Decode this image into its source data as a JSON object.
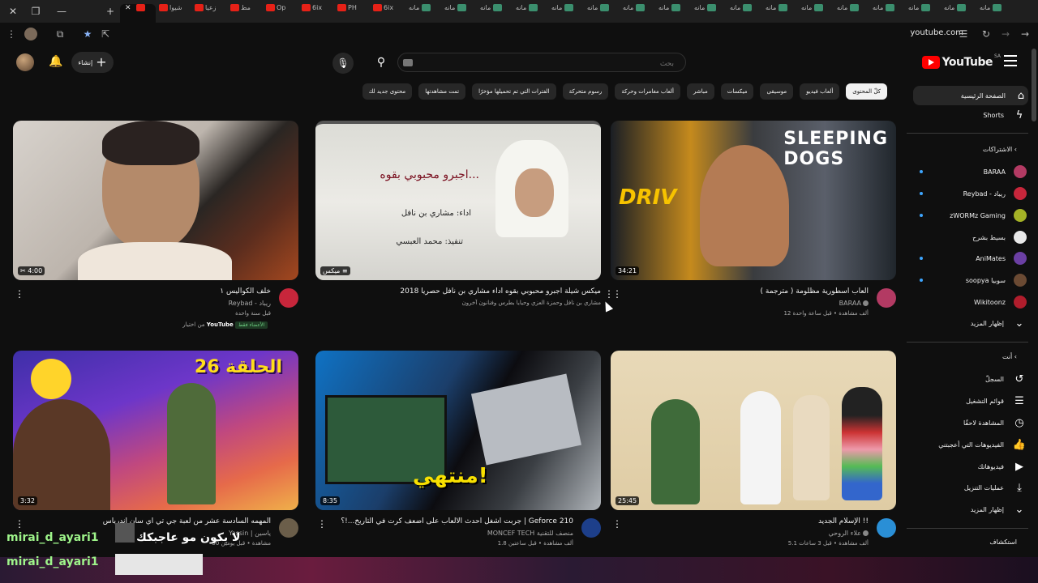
{
  "browser": {
    "tabs": [
      "شيوا",
      "زعيا",
      "مط",
      "Op",
      "6ix",
      "PH",
      "6ix",
      "مانه",
      "مانه",
      "مانه",
      "مانه",
      "مانه",
      "مانه",
      "مانه",
      "مانه",
      "مانه",
      "مانه",
      "مانه",
      "مانه",
      "مانه",
      "مانه",
      "مانه",
      "مانه"
    ],
    "url": "youtube.com"
  },
  "header": {
    "logo_text": "YouTube",
    "logo_region": "SA",
    "search_placeholder": "بحث",
    "create_label": "إنشاء"
  },
  "chips": [
    "كلّ المحتوى",
    "ألعاب فيديو",
    "موسيقى",
    "ميكسات",
    "مباشر",
    "ألعاب مغامرات وحركة",
    "رسوم متحركة",
    "الفترات التي تم تحميلها مؤخرًا",
    "تمت مشاهدتها",
    "محتوى جديد لك"
  ],
  "sidebar": {
    "main": [
      {
        "label": "الصفحة الرئيسية",
        "icon": "home-icon"
      },
      {
        "label": "Shorts",
        "icon": "shorts-icon"
      }
    ],
    "subscriptions_heading": "الاشتراكات",
    "subscriptions": [
      {
        "label": "BARAA",
        "color": "#b33a63"
      },
      {
        "label": "Reybad - ريباد",
        "color": "#c7263b"
      },
      {
        "label": "zWORMz Gaming",
        "color": "#a4b226"
      },
      {
        "label": "بسيط بشرح",
        "color": "#e8e8e8"
      },
      {
        "label": "AniMates",
        "color": "#6b3fa3"
      },
      {
        "label": "soopya سوبيا",
        "color": "#6b4a33"
      },
      {
        "label": "Wikitoonz",
        "color": "#b01d2c"
      }
    ],
    "show_more": "إظهار المزيد",
    "you_heading": "أنت",
    "you": [
      {
        "label": "السجلّ",
        "icon": "history-icon"
      },
      {
        "label": "قوائم التشغيل",
        "icon": "playlists-icon"
      },
      {
        "label": "المشاهدة لاحقًا",
        "icon": "watch-later-icon"
      },
      {
        "label": "الفيديوهات التي أعجبتني",
        "icon": "like-icon"
      },
      {
        "label": "فيديوهاتك",
        "icon": "your-videos-icon"
      },
      {
        "label": "عمليات التنزيل",
        "icon": "download-icon"
      }
    ],
    "show_more_2": "إظهار المزيد",
    "explore_heading": "استكشاف"
  },
  "videos": [
    {
      "title": "ألعاب أسطورية مظلومة ( مترجمة )",
      "channel": "BARAA",
      "stats": "12 ألف مشاهدة • قبل ساعة واحدة",
      "duration": "34:21",
      "avatar_color": "#b33a63",
      "thumb": "t3"
    },
    {
      "title": "ميكس شيلة اجبرو محبوبي بقوه   اداء مشاري بن نافل   حصريا 2018",
      "channel": "مشاري بن نافل وحمزة العزي وحيايا بطرس وفنانون آخرون",
      "stats": "",
      "duration": "ميكس",
      "avatar_color": "",
      "thumb": "t2"
    },
    {
      "title": "خلف الكواليس ١",
      "channel": "Reybad - ريباد",
      "stats": "قبل سنة واحدة",
      "extra_pre": "من اختيار",
      "extra_brand": "YouTube",
      "extra_badge": "الأعضاء فقط",
      "duration": "4:00",
      "avatar_color": "#c7263b",
      "thumb": "t1"
    },
    {
      "title": "الإسلام الجديد !!",
      "channel": "علاء الروحي",
      "stats": "5.1 ألف مشاهدة • قبل 3 ساعات",
      "duration": "25:45",
      "avatar_color": "#2a8fd6",
      "thumb": "t6"
    },
    {
      "title": "جربت أشغل أحدث الألعاب على أضعف كرت في التاريخ...!؟ | Geforce 210",
      "channel": "MONCEF TECH منصف للتقنية",
      "stats": "1.8 ألف مشاهدة • قبل ساعتين",
      "duration": "8:35",
      "avatar_color": "#1d3f8a",
      "thumb": "t5"
    },
    {
      "title": "المهمه السادسة عشر من لعبة جي تي اي سان اندرياس",
      "channel": "Yassin | ياسين",
      "stats": "50 مشاهدة • قبل يومين",
      "duration": "3:32",
      "avatar_color": "#6b5e4a",
      "thumb": "t4"
    }
  ],
  "thumb_text": {
    "v2_line1": "اجبرو محبوبي بقوه...",
    "v2_line2": "اداء: مشاري بن نافل",
    "v2_line3": "تنفيذ: محمد العبسي",
    "v5_word": "منتهي!",
    "v4_number": "الحلقة 26"
  },
  "overlay": {
    "chat_user_1": "mirai_d_ayari1",
    "chat_user_2": "mirai_d_ayari1",
    "chat_message": "لا يكون مو عاجبكك"
  }
}
